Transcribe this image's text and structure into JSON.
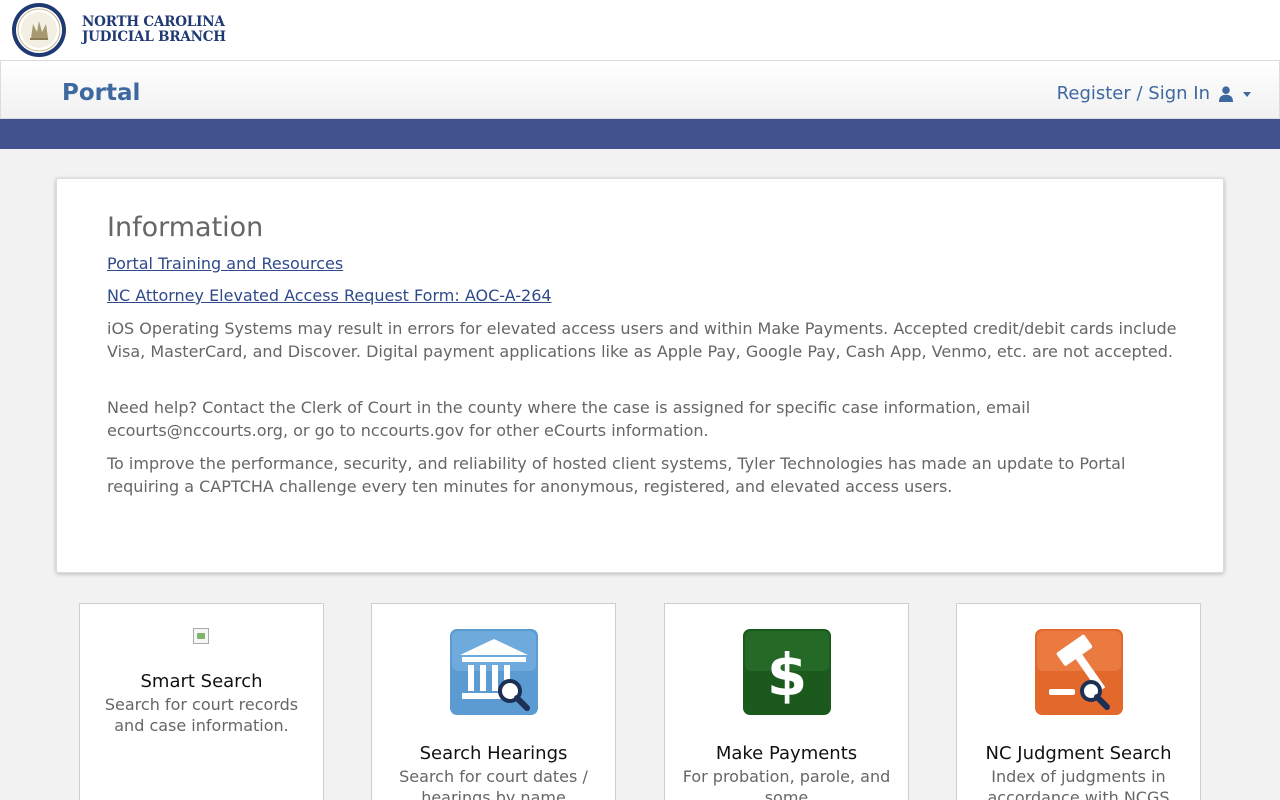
{
  "brand": {
    "line1": "NORTH CAROLINA",
    "line2": "JUDICIAL BRANCH",
    "logo_icon": "nc-judicial-seal-icon"
  },
  "navbar": {
    "title": "Portal",
    "signin_label": "Register / Sign In",
    "user_icon": "user-icon",
    "caret_icon": "caret-down-icon"
  },
  "information": {
    "title": "Information",
    "link_training": "Portal Training and Resources",
    "link_attorney": "NC Attorney Elevated Access Request Form: AOC-A-264",
    "para_ios": "iOS Operating Systems may result in errors for elevated access users and within Make Payments. Accepted credit/debit cards include Visa, MasterCard, and Discover. Digital payment applications like as Apple Pay, Google Pay, Cash App, Venmo, etc. are not accepted.",
    "para_help": "Need help? Contact the Clerk of Court in the county where the case is assigned for specific case information, email ecourts@nccourts.org, or go to nccourts.gov for other eCourts information.",
    "para_captcha": "To improve the performance, security, and reliability of hosted client systems, Tyler Technologies has made an update to Portal requiring a CAPTCHA challenge every ten minutes for anonymous, registered, and elevated access users."
  },
  "tiles": [
    {
      "title": "Smart Search",
      "desc": "Search for court records and case information.",
      "icon": "broken-image-icon"
    },
    {
      "title": "Search Hearings",
      "desc": "Search for court dates / hearings by name",
      "icon": "courthouse-search-icon"
    },
    {
      "title": "Make Payments",
      "desc": "For probation, parole, and some",
      "icon": "dollar-icon"
    },
    {
      "title": "NC Judgment Search",
      "desc": "Index of judgments in accordance with NCGS",
      "icon": "gavel-search-icon"
    }
  ],
  "colors": {
    "brand_navy": "#1f3a73",
    "portal_blue": "#3e68a0",
    "band_blue": "#42528f",
    "hearings_blue": "#5b9bd1",
    "payments_green": "#1b5a1c",
    "judgment_orange": "#e2682c"
  }
}
